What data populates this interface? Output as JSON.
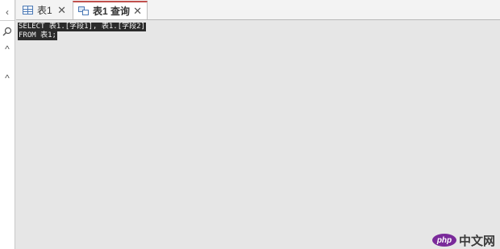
{
  "tabs": [
    {
      "label": "表1",
      "icon": "table-icon",
      "active": false
    },
    {
      "label": "表1 查询",
      "icon": "query-icon",
      "active": true
    }
  ],
  "tab_close_glyph": "✕",
  "left_nav": {
    "collapse_glyph": "‹",
    "search_glyph": "⚲",
    "up_glyph": "^"
  },
  "editor": {
    "lines": [
      "SELECT 表1.[字段1], 表1.[字段2]",
      "FROM 表1;"
    ]
  },
  "watermark": {
    "badge": "php",
    "text": "中文网"
  },
  "colors": {
    "active_tab_accent": "#c0504d",
    "selection_bg": "#2b2b2b",
    "editor_bg": "#e6e6e6"
  }
}
